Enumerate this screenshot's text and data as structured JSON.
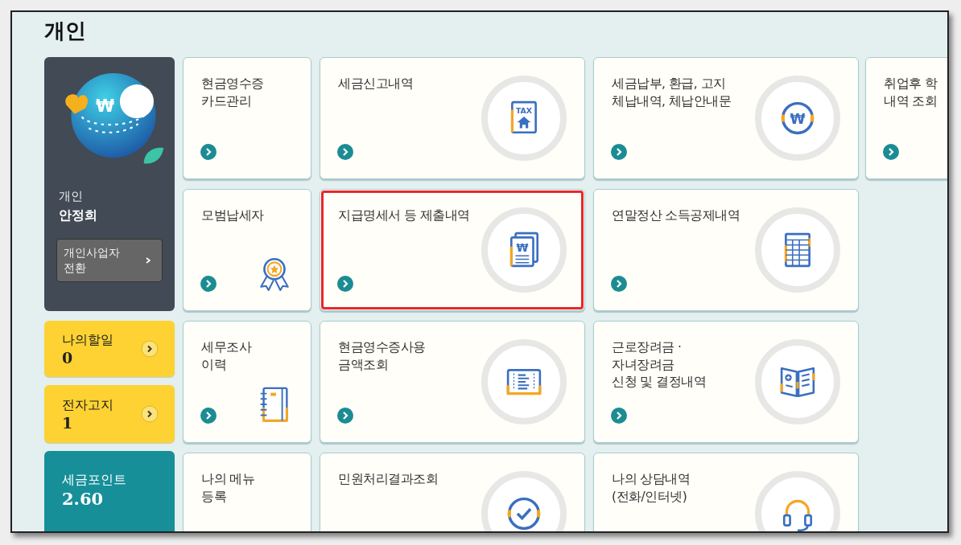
{
  "title": "개인",
  "profile": {
    "avatar_symbol": "₩",
    "type": "개인",
    "name": "안정희",
    "switch_button": "개인사업자\n전환"
  },
  "todo_cards": [
    {
      "label": "나의할일",
      "count": "0"
    },
    {
      "label": "전자고지",
      "count": "1"
    }
  ],
  "points": {
    "label": "세금포인트",
    "value": "2.60"
  },
  "tile_rows": [
    [
      {
        "kind": "narrow",
        "label": "현금영수증\n카드관리",
        "selected": false
      },
      {
        "kind": "wide",
        "label": "세금신고내역",
        "selected": false,
        "icon_label": "TAX"
      },
      {
        "kind": "wide",
        "label": "세금납부, 환급, 고지\n체납내역, 체납안내문",
        "selected": false,
        "icon_label": "₩"
      },
      {
        "kind": "cut",
        "label": "취업후 학\n내역 조회",
        "selected": false
      }
    ],
    [
      {
        "kind": "narrow",
        "label": "모범납세자",
        "selected": false
      },
      {
        "kind": "wide",
        "label": "지급명세서 등 제출내역",
        "selected": true,
        "icon_label": "₩"
      },
      {
        "kind": "wide",
        "label": "연말정산 소득공제내역",
        "selected": false
      }
    ],
    [
      {
        "kind": "narrow",
        "label": "세무조사\n이력",
        "selected": false
      },
      {
        "kind": "wide",
        "label": "현금영수증사용\n금액조회",
        "selected": false
      },
      {
        "kind": "wide",
        "label": "근로장려금 ·\n자녀장려금\n신청 및 결정내역",
        "selected": false
      }
    ],
    [
      {
        "kind": "narrow",
        "label": "나의 메뉴\n등록",
        "selected": false
      },
      {
        "kind": "wide",
        "label": "민원처리결과조회",
        "selected": false
      },
      {
        "kind": "wide",
        "label": "나의 상담내역\n(전화/인터넷)",
        "selected": false
      }
    ]
  ]
}
